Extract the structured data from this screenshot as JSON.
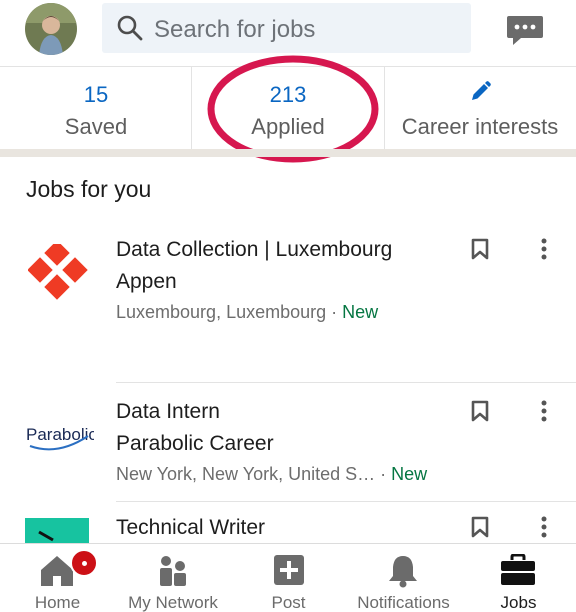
{
  "search": {
    "placeholder": "Search for jobs"
  },
  "stats": {
    "saved": {
      "count": "15",
      "label": "Saved"
    },
    "applied": {
      "count": "213",
      "label": "Applied"
    },
    "career": {
      "label": "Career interests",
      "icon": "pencil-icon"
    }
  },
  "section": {
    "title": "Jobs for you"
  },
  "jobs": [
    {
      "title": "Data Collection | Luxembourg",
      "company": "Appen",
      "location": "Luxembourg, Luxembourg",
      "separator": " · ",
      "tag": "New"
    },
    {
      "title": "Data Intern",
      "company": "Parabolic Career",
      "location": "New York, New York, United S…",
      "separator": " · ",
      "tag": "New",
      "logo_text": "Parabolic"
    },
    {
      "title": "Technical Writer"
    }
  ],
  "nav": {
    "items": [
      {
        "label": "Home",
        "icon": "home-icon"
      },
      {
        "label": "My Network",
        "icon": "network-icon"
      },
      {
        "label": "Post",
        "icon": "post-icon"
      },
      {
        "label": "Notifications",
        "icon": "bell-icon"
      },
      {
        "label": "Jobs",
        "icon": "briefcase-icon",
        "active": true
      }
    ]
  },
  "colors": {
    "accent": "#0a66c2",
    "new": "#057642",
    "highlight": "#d6174f",
    "badge": "#cc1016"
  }
}
